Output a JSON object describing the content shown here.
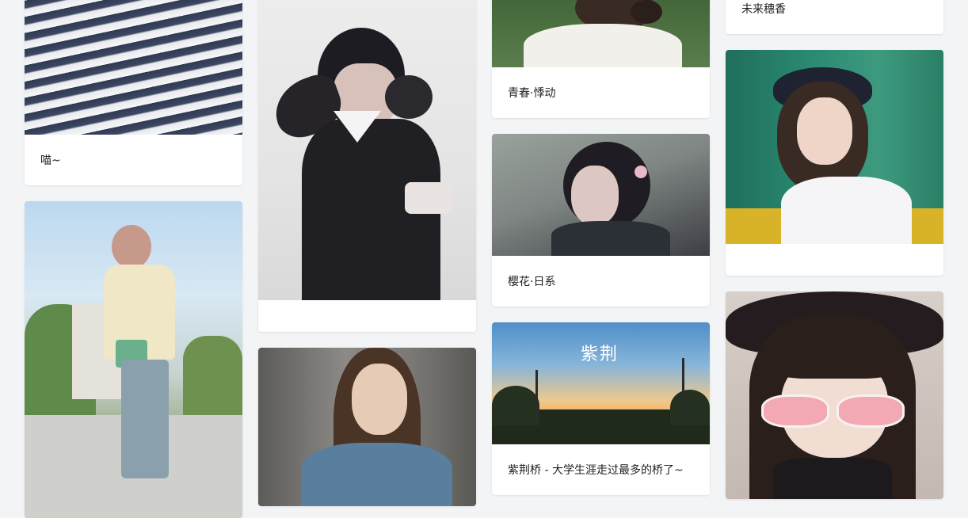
{
  "gallery": {
    "cards": [
      {
        "caption": "喵~",
        "image": "striped-fabric-photo"
      },
      {
        "caption": "",
        "image": "woman-street-photo"
      },
      {
        "caption": "",
        "image": "anime-boy-crows-illustration"
      },
      {
        "caption": "",
        "image": "girl-denim-jacket-photo"
      },
      {
        "caption": "青春·悸动",
        "image": "girl-backview-photo"
      },
      {
        "caption": "樱花·日系",
        "image": "anime-girl-sakura-illustration"
      },
      {
        "caption": "紫荆桥 - 大学生涯走过最多的桥了~",
        "image": "sunset-streetlight-photo"
      },
      {
        "caption": "未来穗香",
        "image": ""
      },
      {
        "caption": "",
        "image": "girl-hat-train-photo"
      },
      {
        "caption": "",
        "image": "child-pink-sunglasses-photo"
      }
    ],
    "image_text": {
      "sunset_calligraphy": "紫荆"
    }
  }
}
